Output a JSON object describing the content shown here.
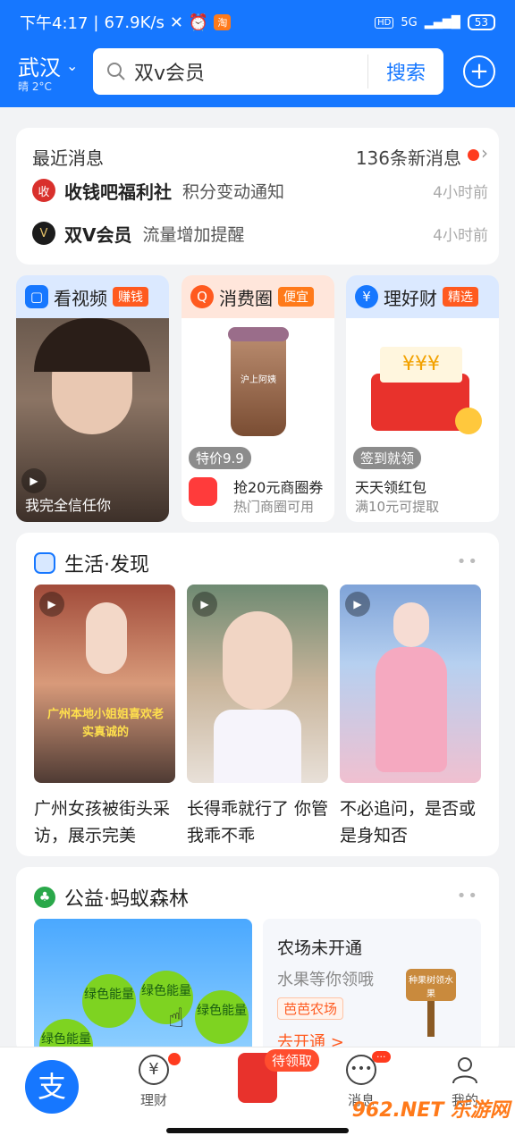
{
  "status": {
    "time": "下午4:17",
    "speed": "67.9K/s",
    "app_badge": "淘",
    "network": "5G",
    "battery": "53",
    "hd": "HD"
  },
  "header": {
    "city": "武汉",
    "weather": "晴 2°C",
    "search_placeholder": "双v会员",
    "search_button": "搜索"
  },
  "messages": {
    "title": "最近消息",
    "count_text": "136条新消息",
    "items": [
      {
        "avatar": "收",
        "source": "收钱吧福利社",
        "text": "积分变动通知",
        "time": "4小时前"
      },
      {
        "avatar": "V",
        "source": "双V会员",
        "text": "流量增加提醒",
        "time": "4小时前"
      }
    ]
  },
  "features": [
    {
      "title": "看视频",
      "tag": "赚钱",
      "caption": "我完全信任你"
    },
    {
      "title": "消费圈",
      "tag": "便宜",
      "price_badge": "特价9.9",
      "main": "抢20元商圈券",
      "sub": "热门商圈可用",
      "cup_text": "沪上阿姨"
    },
    {
      "title": "理好财",
      "tag": "精选",
      "badge": "签到就领",
      "main": "天天领红包",
      "sub": "满10元可提取"
    }
  ],
  "life": {
    "title": "生活·发现",
    "videos": [
      {
        "caption": "广州女孩被街头采访，展示完美",
        "overlay": "广州本地小姐姐喜欢老实真诚的"
      },
      {
        "caption": "长得乖就行了 你管我乖不乖"
      },
      {
        "caption": "不必追问，是否或是身知否"
      }
    ]
  },
  "forest": {
    "title": "公益·蚂蚁森林",
    "energy": [
      "绿色能量",
      "绿色能量",
      "绿色能量",
      "绿色能量"
    ],
    "farm_title": "农场未开通",
    "farm_sub": "水果等你领哦",
    "farm_tag": "芭芭农场",
    "farm_link": "去开通 >",
    "farm_sign": "种果树领水果"
  },
  "tabbar": {
    "items": [
      {
        "label": ""
      },
      {
        "label": "理财"
      },
      {
        "label": "待领取"
      },
      {
        "label": "消息",
        "badge": "···"
      },
      {
        "label": "我的"
      }
    ]
  },
  "watermark": "962.NET 乐游网",
  "colors": {
    "brand": "#1677ff",
    "red": "#ff3b1f",
    "orange": "#ff7a1a"
  }
}
